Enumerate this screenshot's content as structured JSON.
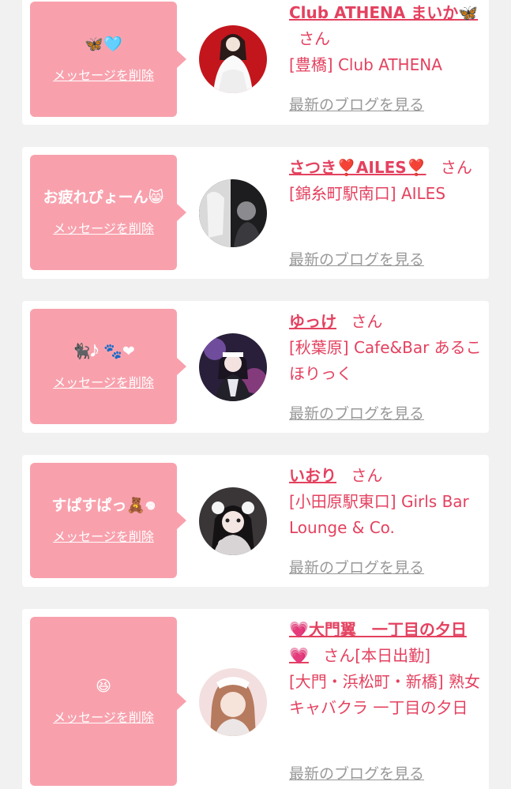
{
  "messages": [
    {
      "bubble_text": "🦋🩵",
      "delete_label": "メッセージを削除",
      "name": "Club ATHENA まいか🦋",
      "san": "さん",
      "suffix": "",
      "shop": "[豊橋] Club ATHENA",
      "blog_label": "最新のブログを見る"
    },
    {
      "bubble_text": "お疲れぴょーん😸",
      "delete_label": "メッセージを削除",
      "name": "さつき❣️AILES❣️",
      "san": "さん",
      "suffix": "",
      "shop": "[錦糸町駅南口] AILES",
      "blog_label": "最新のブログを見る"
    },
    {
      "bubble_text": "🐈‍⬛𝅘𝅥𝅮 🐾❤",
      "delete_label": "メッセージを削除",
      "name": "ゆっけ",
      "san": "さん",
      "suffix": "",
      "shop": "[秋葉原] Cafe&Bar あるこほりっく",
      "blog_label": "最新のブログを見る"
    },
    {
      "bubble_text": "すぱすぱっ🧸𖦹",
      "delete_label": "メッセージを削除",
      "name": "いおり",
      "san": "さん",
      "suffix": "",
      "shop": "[小田原駅東口] Girls Bar Lounge & Co.",
      "blog_label": "最新のブログを見る"
    },
    {
      "bubble_text": "😆",
      "delete_label": "メッセージを削除",
      "name": "💗大門翼　一丁目の夕日💗",
      "san": "さん",
      "suffix": "[本日出勤]",
      "shop": "[大門・浜松町・新橋] 熟女キャバクラ 一丁目の夕日",
      "blog_label": "最新のブログを見る"
    }
  ]
}
